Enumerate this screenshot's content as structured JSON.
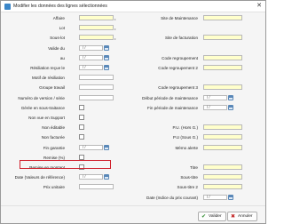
{
  "window": {
    "title": "Modifier les données des lignes sélectionnées"
  },
  "left_fields": [
    {
      "label": "Affaire",
      "kind": "input",
      "required": true
    },
    {
      "label": "Lot",
      "kind": "input",
      "required": true
    },
    {
      "label": "Sous-lot",
      "kind": "input",
      "required": true
    },
    {
      "label": "Valide du",
      "kind": "date",
      "value": "/ /"
    },
    {
      "label": "au",
      "kind": "date",
      "value": "/ /"
    },
    {
      "label": "Résiliation reçue le",
      "kind": "date",
      "value": "/ /"
    },
    {
      "label": "Motif de résiliation",
      "kind": "input"
    },
    {
      "label": "Groupe travail",
      "kind": "input"
    },
    {
      "label": "Numéro de version / série",
      "kind": "input"
    },
    {
      "label": "Gérée en sous-traitance",
      "kind": "checkbox"
    },
    {
      "label": "Non vue en Support",
      "kind": "checkbox"
    },
    {
      "label": "Non éditable",
      "kind": "checkbox"
    },
    {
      "label": "Non facturée",
      "kind": "checkbox"
    },
    {
      "label": "Fin garantie",
      "kind": "date",
      "value": "/ /"
    },
    {
      "label": "Remise (%)",
      "kind": "checkbox"
    },
    {
      "label": "Remise en montant",
      "kind": "checkbox"
    },
    {
      "label": "Date (Valeurs de référence)",
      "kind": "date",
      "value": "/ /"
    },
    {
      "label": "Prix unitaire",
      "kind": "input"
    }
  ],
  "right_fields": [
    {
      "label": "Site de Maintenance",
      "kind": "input",
      "row": 0
    },
    {
      "label": "Site de facturation",
      "kind": "input",
      "row": 2
    },
    {
      "label": "Code regroupement",
      "kind": "input",
      "row": 4
    },
    {
      "label": "Code regroupement 2",
      "kind": "input",
      "row": 5
    },
    {
      "label": "Code regroupement 3",
      "kind": "input",
      "row": 7
    },
    {
      "label": "Début période de maintenance",
      "kind": "date",
      "row": 8,
      "value": "/ /"
    },
    {
      "label": "Fin période de maintenance",
      "kind": "date",
      "row": 9,
      "value": "/ /"
    },
    {
      "label": "P.U. (Hors G.)",
      "kind": "input",
      "row": 11
    },
    {
      "label": "P.U (Sous G.)",
      "kind": "input",
      "row": 12
    },
    {
      "label": "Mémo alerte",
      "kind": "input",
      "row": 13
    },
    {
      "label": "Titre",
      "kind": "input",
      "row": 15
    },
    {
      "label": "Sous-titre",
      "kind": "input",
      "row": 16
    },
    {
      "label": "Sous-titre 2",
      "kind": "input",
      "row": 17
    },
    {
      "label": "Date (Indice du prix courant)",
      "kind": "date",
      "row": 18,
      "value": "/ /"
    }
  ],
  "buttons": {
    "validate": "Valider",
    "cancel": "Annuler"
  },
  "colors": {
    "required_field": "#ffffcc",
    "highlight": "#d0202c",
    "ok": "#2e8b2e",
    "cancel": "#c02020"
  }
}
